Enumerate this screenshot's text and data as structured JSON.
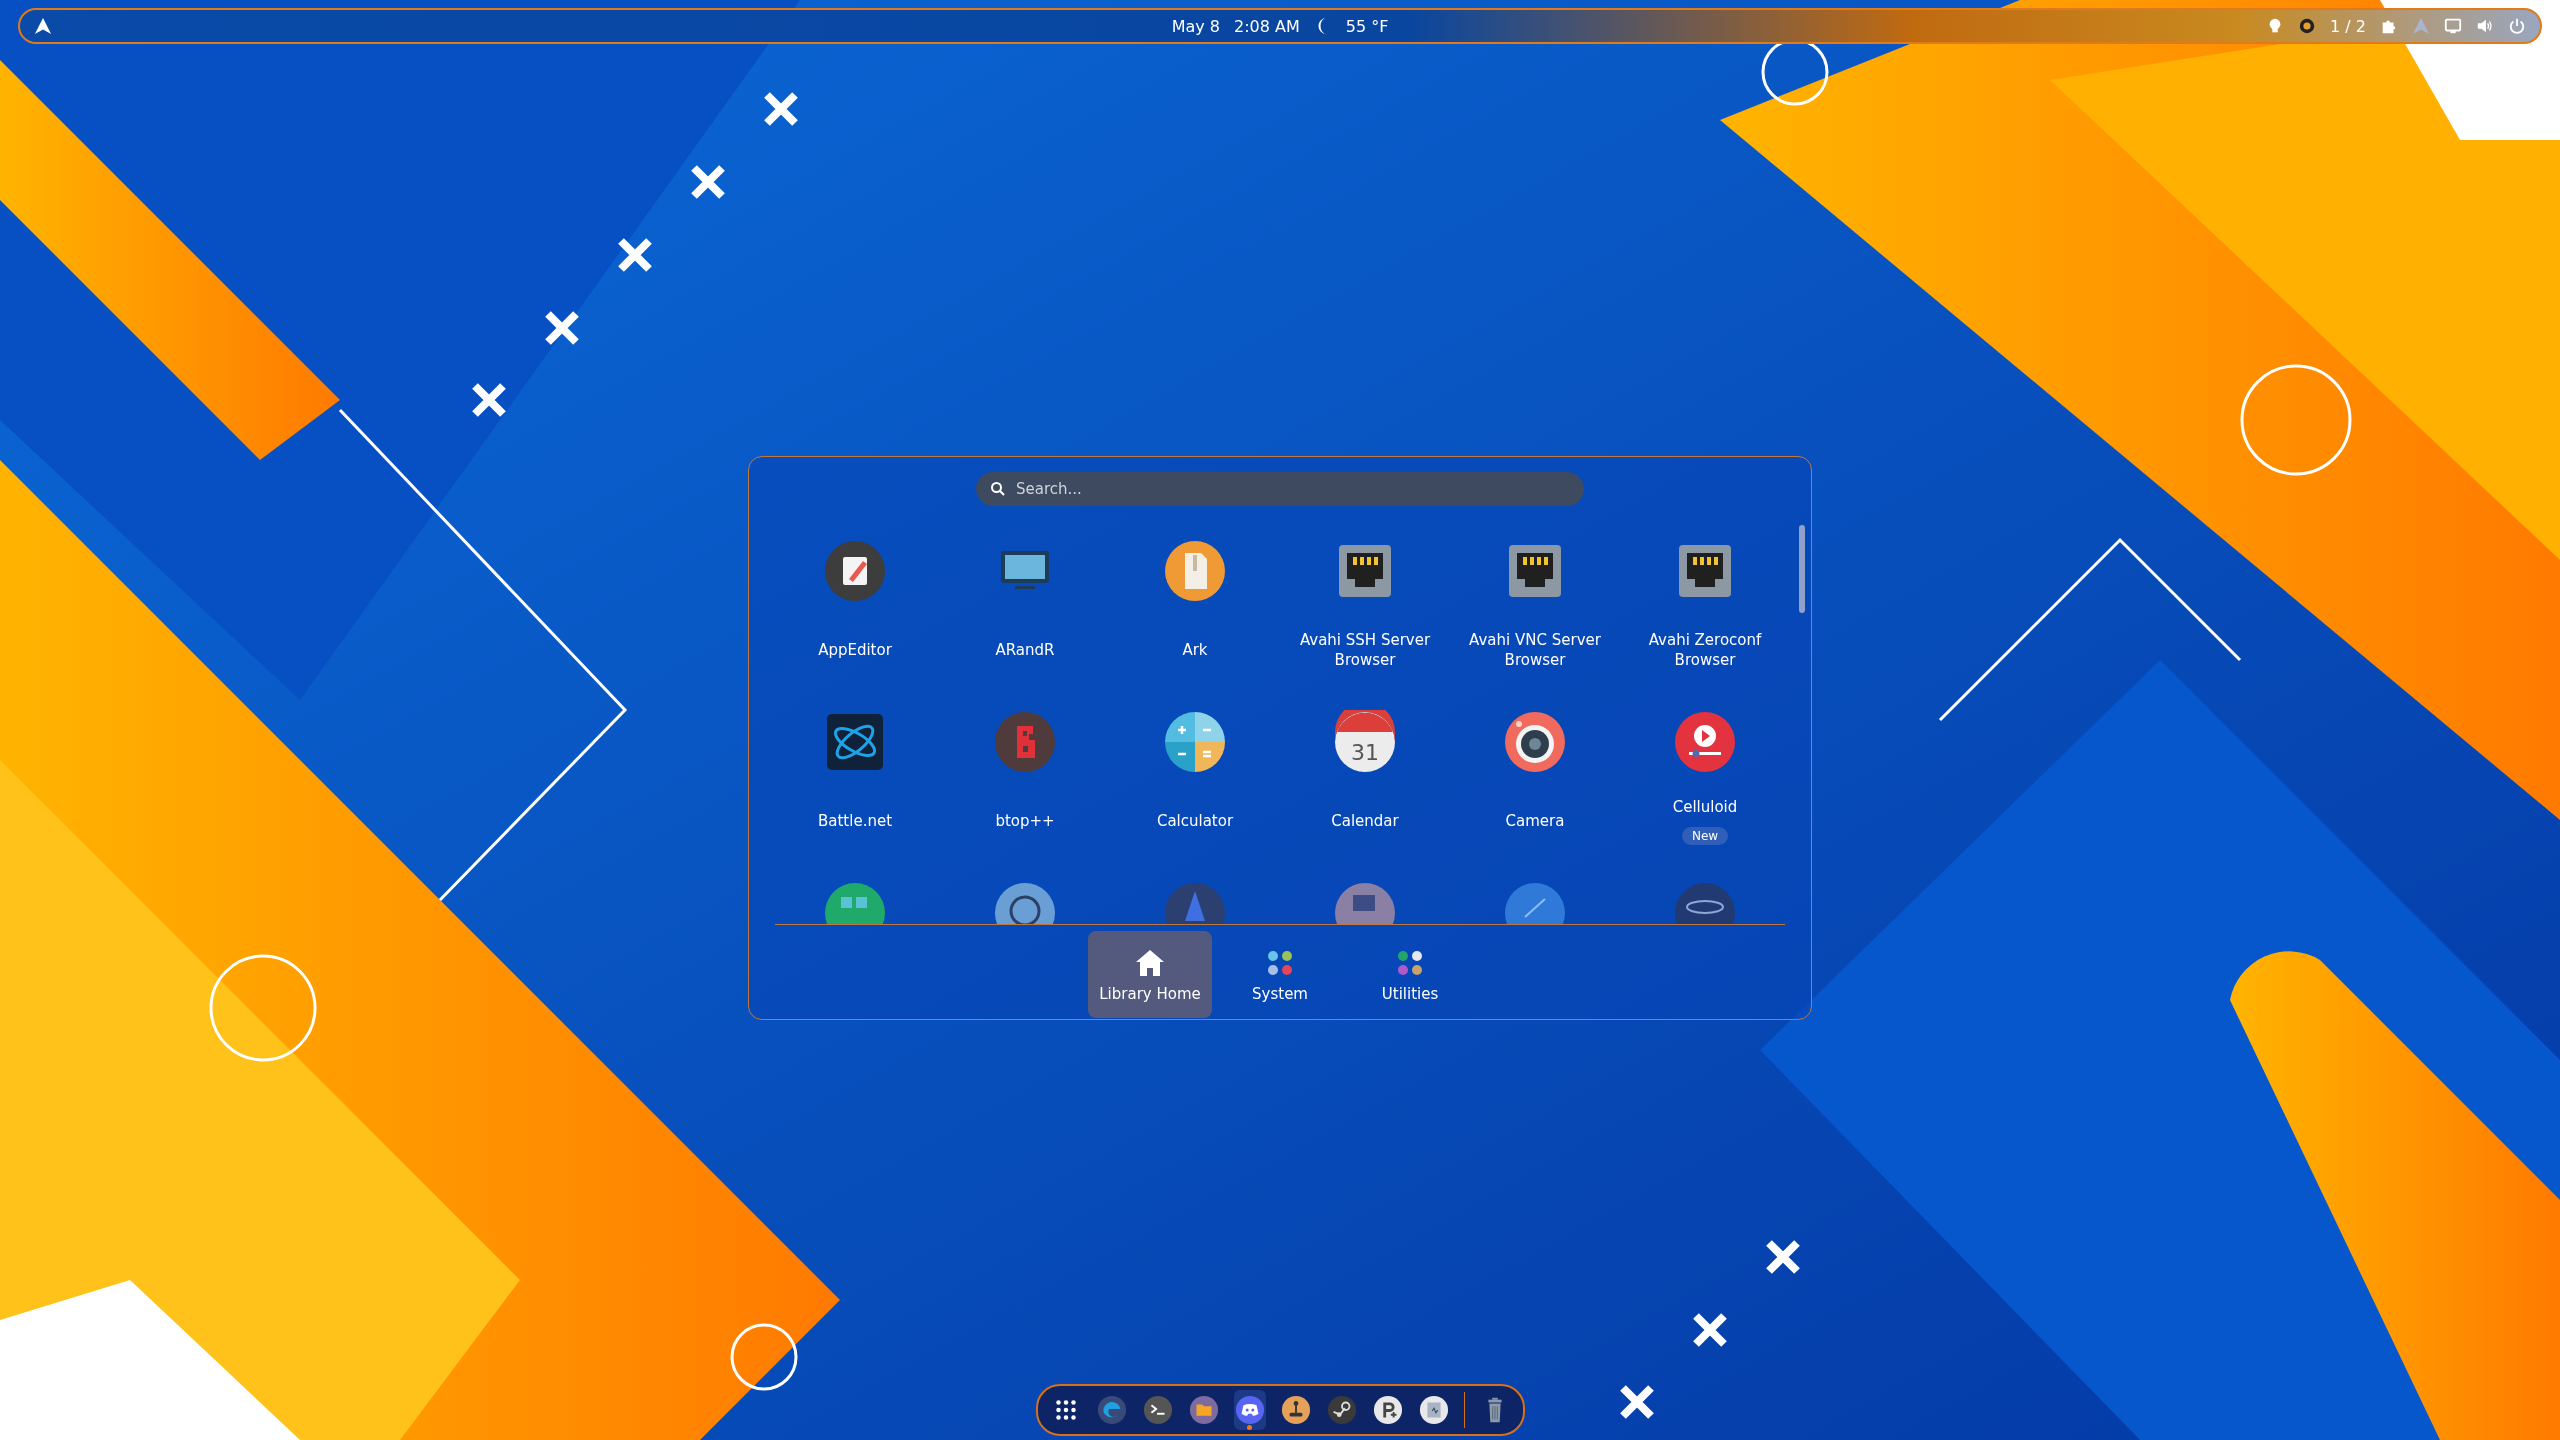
{
  "top_bar": {
    "date": "May 8",
    "time": "2:08 AM",
    "weather": "55 °F",
    "workspace": "1 / 2"
  },
  "launcher": {
    "search": {
      "placeholder": "Search..."
    },
    "apps": [
      {
        "label": "AppEditor",
        "kind": "editor"
      },
      {
        "label": "ARandR",
        "kind": "monitor"
      },
      {
        "label": "Ark",
        "kind": "archive"
      },
      {
        "label": "Avahi SSH Server Browser",
        "kind": "network"
      },
      {
        "label": "Avahi VNC Server Browser",
        "kind": "network"
      },
      {
        "label": "Avahi Zeroconf Browser",
        "kind": "network"
      },
      {
        "label": "Battle.net",
        "kind": "battlenet"
      },
      {
        "label": "btop++",
        "kind": "btop"
      },
      {
        "label": "Calculator",
        "kind": "calculator"
      },
      {
        "label": "Calendar",
        "kind": "calendar",
        "day": "31"
      },
      {
        "label": "Camera",
        "kind": "camera"
      },
      {
        "label": "Celluloid",
        "kind": "player",
        "badge": "New"
      }
    ],
    "partial_row": [
      {
        "kind": "green"
      },
      {
        "kind": "gauge"
      },
      {
        "kind": "dark"
      },
      {
        "kind": "mauve"
      },
      {
        "kind": "sky"
      },
      {
        "kind": "atom"
      }
    ],
    "categories": [
      {
        "label": "Library Home",
        "kind": "home",
        "selected": true
      },
      {
        "label": "System",
        "kind": "grid",
        "selected": false
      },
      {
        "label": "Utilities",
        "kind": "grid2",
        "selected": false
      }
    ]
  },
  "dock": {
    "items": [
      {
        "kind": "apps",
        "running": false
      },
      {
        "kind": "browser",
        "running": false
      },
      {
        "kind": "terminal",
        "running": false
      },
      {
        "kind": "files",
        "running": false
      },
      {
        "kind": "chat",
        "running": true
      },
      {
        "kind": "joystick",
        "running": false
      },
      {
        "kind": "steam",
        "running": false
      },
      {
        "kind": "pplus",
        "running": false
      },
      {
        "kind": "monitor",
        "running": false
      },
      {
        "kind": "trash",
        "running": false
      }
    ]
  }
}
